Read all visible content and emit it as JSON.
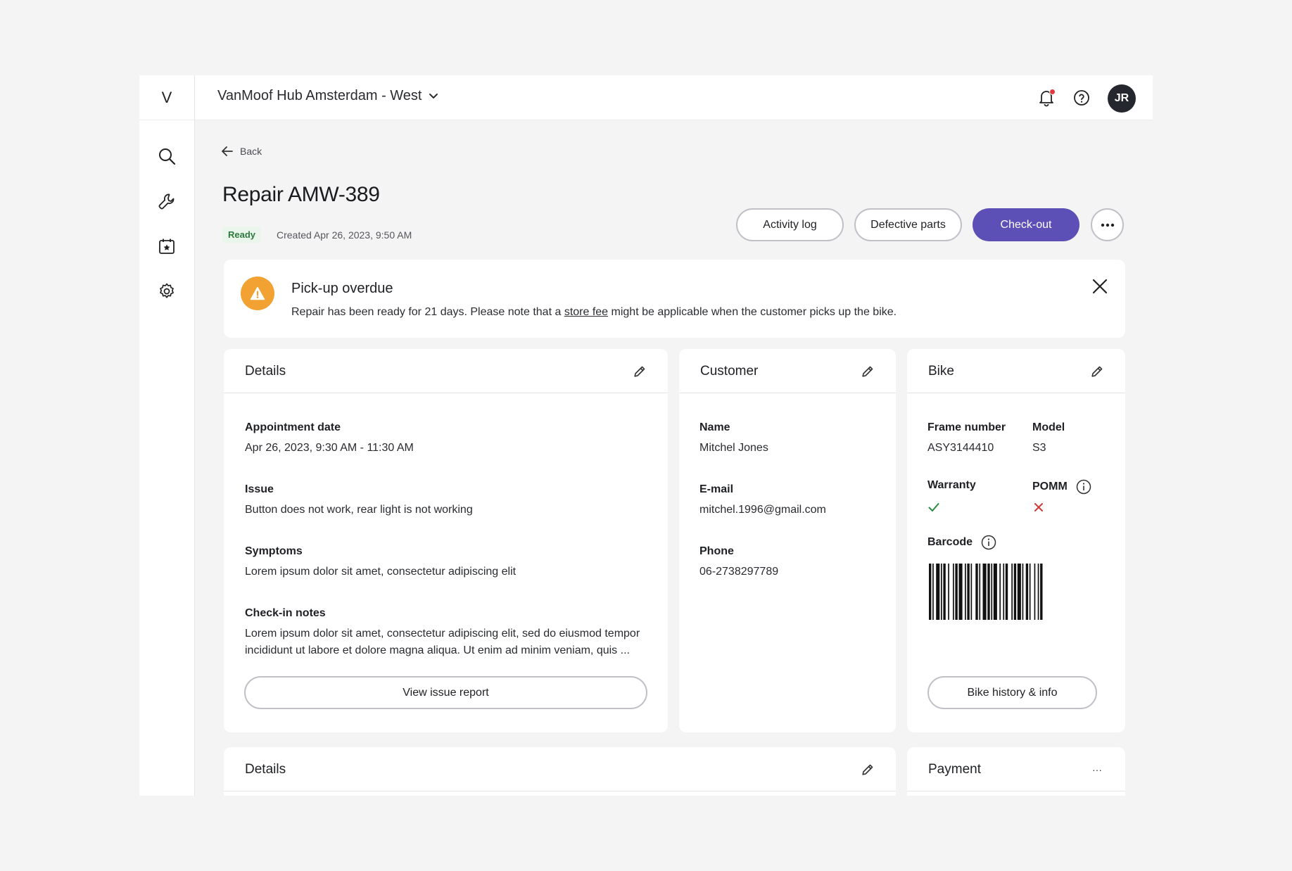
{
  "logo": "V",
  "topbar": {
    "location": "VanMoof Hub Amsterdam - West",
    "avatar_initials": "JR"
  },
  "nav": {
    "back_label": "Back"
  },
  "repair": {
    "title": "Repair AMW-389",
    "status": "Ready",
    "created": "Created Apr 26, 2023, 9:50 AM"
  },
  "actions": {
    "activity_log": "Activity log",
    "defective_parts": "Defective parts",
    "check_out": "Check-out"
  },
  "alert": {
    "title": "Pick-up overdue",
    "text_before": "Repair has been ready for 21 days. Please note that a ",
    "link": "store fee",
    "text_after": " might be applicable when the customer picks up the bike.",
    "accent_color": "#f2a233"
  },
  "details": {
    "title": "Details",
    "appointment_label": "Appointment date",
    "appointment_value": "Apr 26, 2023, 9:30 AM - 11:30 AM",
    "issue_label": "Issue",
    "issue_value": "Button does not work, rear light is not working",
    "symptoms_label": "Symptoms",
    "symptoms_value": "Lorem ipsum dolor sit amet, consectetur adipiscing elit",
    "notes_label": "Check-in notes",
    "notes_line1": "Lorem ipsum dolor sit amet, consectetur adipiscing elit, sed do eiusmod tempor",
    "notes_line2": "incididunt ut labore et dolore magna aliqua. Ut enim ad minim veniam, quis ...",
    "report_button": "View issue report"
  },
  "customer": {
    "title": "Customer",
    "name_label": "Name",
    "name_value": "Mitchel Jones",
    "email_label": "E-mail",
    "email_value": "mitchel.1996@gmail.com",
    "phone_label": "Phone",
    "phone_value": "06-2738297789"
  },
  "bike": {
    "title": "Bike",
    "frame_label": "Frame number",
    "frame_value": "ASY3144410",
    "model_label": "Model",
    "model_value": "S3",
    "warranty_label": "Warranty",
    "warranty_status": "check-icon",
    "pomm_label": "POMM",
    "pomm_status": "cross-icon",
    "barcode_label": "Barcode",
    "history_button": "Bike history & info"
  },
  "lower": {
    "details_title": "Details",
    "payment_title": "Payment",
    "payment_menu": "···"
  },
  "colors": {
    "primary": "#5c4fb6",
    "status_ready_bg": "#eaf5ec",
    "status_ready_text": "#2c7a3a",
    "success": "#2c8a3e",
    "danger": "#d13a3a",
    "notification": "#e0383e"
  }
}
